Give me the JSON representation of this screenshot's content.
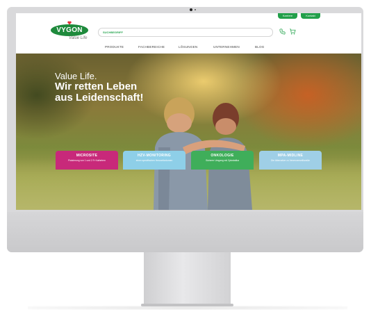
{
  "header": {
    "top_buttons": [
      "Karriere",
      "Kontakt"
    ],
    "logo_text": "VYGON",
    "tagline": "Value Life",
    "search_placeholder": "SUCHBEGRIFF"
  },
  "nav": {
    "items": [
      "PRODUKTE",
      "FACHBEREICHE",
      "LÖSUNGEN",
      "UNTERNEHMEN",
      "BLOG"
    ]
  },
  "hero": {
    "line1": "Value Life.",
    "line2": "Wir retten Leben",
    "line3": "aus Leidenschaft!"
  },
  "tiles": [
    {
      "title": "MICROSITE",
      "subtitle": "Platzierung von 1 und 2 Fr Kathetern",
      "color": "#c8297a"
    },
    {
      "title": "HZV-MONITORING",
      "subtitle": "einen spezifischen Herzzeitvolumen",
      "color": "#8ecfe8"
    },
    {
      "title": "ONKOLOGIE",
      "subtitle": "Sicherer Umgang mit Zytostatika",
      "color": "#3fae5a"
    },
    {
      "title": "MPA-MIDLINE",
      "subtitle": "Die Alternative zu Venenverweilkanüle",
      "color": "#9fcfe6"
    }
  ],
  "colors": {
    "brand_green": "#1e8a3c",
    "accent_green": "#22a04a"
  },
  "icons": [
    "phone-icon",
    "cart-icon",
    "heart-icon"
  ]
}
